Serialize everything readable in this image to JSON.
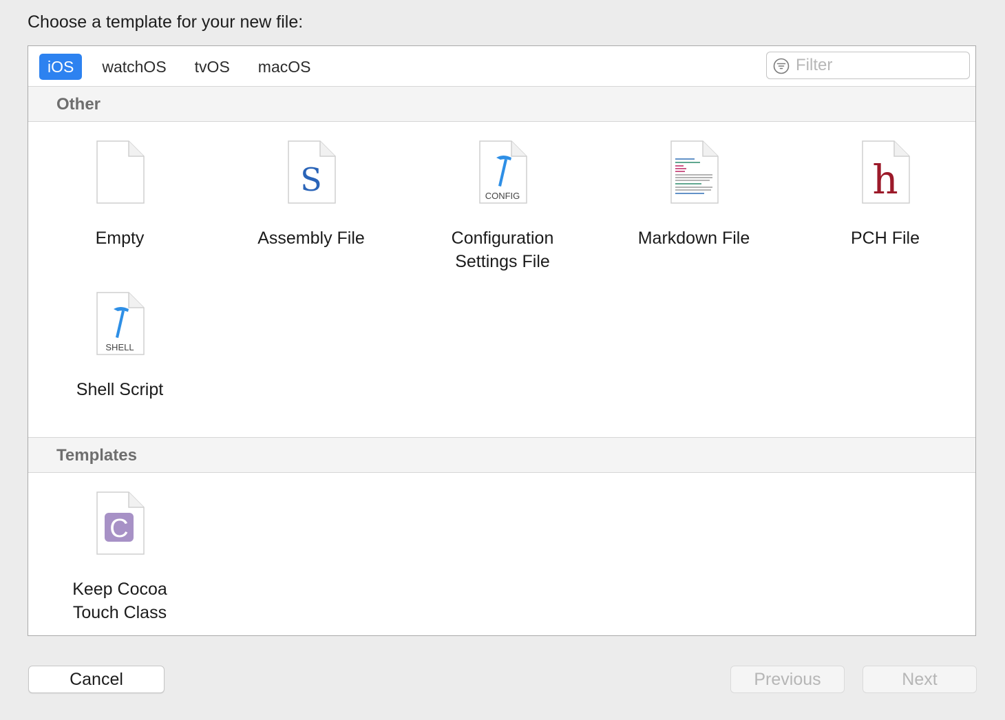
{
  "prompt": "Choose a template for your new file:",
  "platform_tabs": [
    {
      "label": "iOS",
      "selected": true
    },
    {
      "label": "watchOS",
      "selected": false
    },
    {
      "label": "tvOS",
      "selected": false
    },
    {
      "label": "macOS",
      "selected": false
    }
  ],
  "filter": {
    "placeholder": "Filter",
    "value": ""
  },
  "sections": [
    {
      "title": "Other",
      "items": [
        {
          "label": "Empty",
          "icon": "empty-file-icon"
        },
        {
          "label": "Assembly File",
          "icon": "assembly-file-icon",
          "glyph": "S"
        },
        {
          "label": "Configuration\nSettings File",
          "icon": "config-file-icon",
          "caption": "CONFIG"
        },
        {
          "label": "Markdown File",
          "icon": "markdown-file-icon"
        },
        {
          "label": "PCH File",
          "icon": "pch-file-icon",
          "glyph": "h"
        },
        {
          "label": "Shell Script",
          "icon": "shell-script-icon",
          "caption": "SHELL"
        }
      ]
    },
    {
      "title": "Templates",
      "items": [
        {
          "label": "Keep Cocoa\nTouch Class",
          "icon": "cocoa-touch-class-icon",
          "glyph": "C"
        }
      ]
    }
  ],
  "buttons": {
    "cancel": "Cancel",
    "previous": "Previous",
    "next": "Next"
  },
  "colors": {
    "accent": "#2d82f0",
    "assembly_glyph": "#2a64b8",
    "pch_glyph": "#9c1a2a",
    "hammer": "#2e8fe6",
    "class_badge": "#a791c6"
  }
}
